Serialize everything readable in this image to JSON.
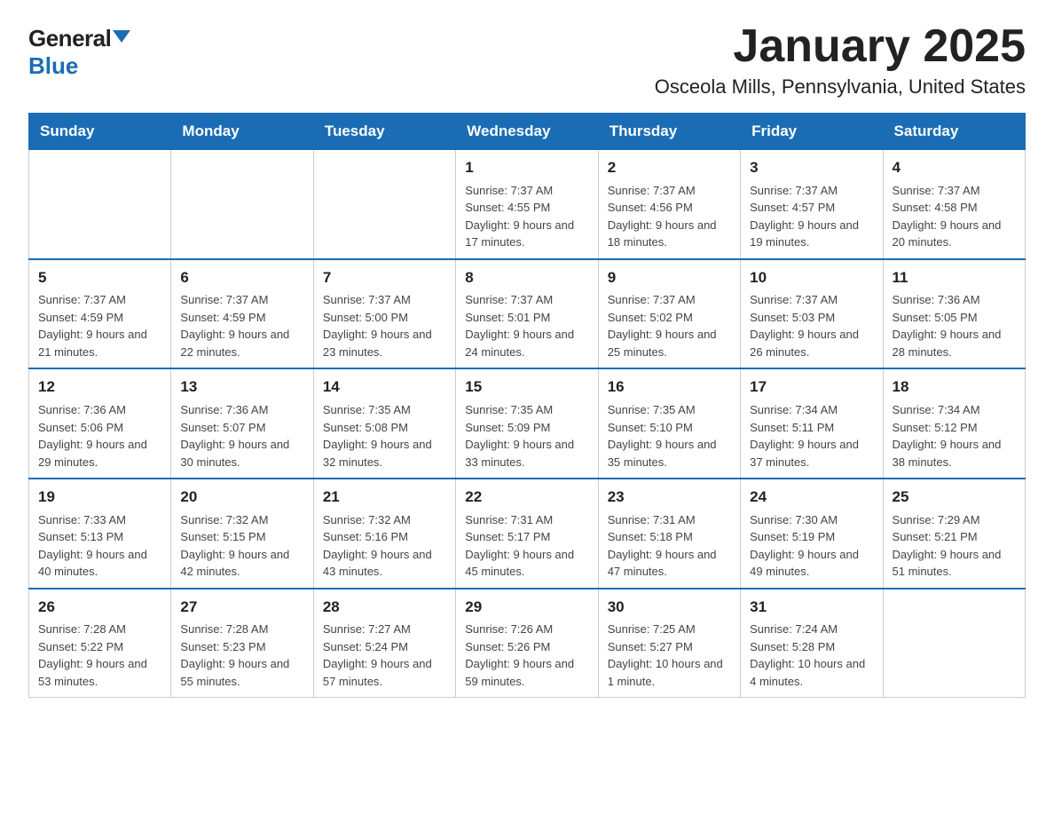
{
  "logo": {
    "general": "General",
    "blue": "Blue"
  },
  "title": "January 2025",
  "subtitle": "Osceola Mills, Pennsylvania, United States",
  "headers": [
    "Sunday",
    "Monday",
    "Tuesday",
    "Wednesday",
    "Thursday",
    "Friday",
    "Saturday"
  ],
  "weeks": [
    [
      {
        "day": "",
        "info": ""
      },
      {
        "day": "",
        "info": ""
      },
      {
        "day": "",
        "info": ""
      },
      {
        "day": "1",
        "info": "Sunrise: 7:37 AM\nSunset: 4:55 PM\nDaylight: 9 hours and 17 minutes."
      },
      {
        "day": "2",
        "info": "Sunrise: 7:37 AM\nSunset: 4:56 PM\nDaylight: 9 hours and 18 minutes."
      },
      {
        "day": "3",
        "info": "Sunrise: 7:37 AM\nSunset: 4:57 PM\nDaylight: 9 hours and 19 minutes."
      },
      {
        "day": "4",
        "info": "Sunrise: 7:37 AM\nSunset: 4:58 PM\nDaylight: 9 hours and 20 minutes."
      }
    ],
    [
      {
        "day": "5",
        "info": "Sunrise: 7:37 AM\nSunset: 4:59 PM\nDaylight: 9 hours and 21 minutes."
      },
      {
        "day": "6",
        "info": "Sunrise: 7:37 AM\nSunset: 4:59 PM\nDaylight: 9 hours and 22 minutes."
      },
      {
        "day": "7",
        "info": "Sunrise: 7:37 AM\nSunset: 5:00 PM\nDaylight: 9 hours and 23 minutes."
      },
      {
        "day": "8",
        "info": "Sunrise: 7:37 AM\nSunset: 5:01 PM\nDaylight: 9 hours and 24 minutes."
      },
      {
        "day": "9",
        "info": "Sunrise: 7:37 AM\nSunset: 5:02 PM\nDaylight: 9 hours and 25 minutes."
      },
      {
        "day": "10",
        "info": "Sunrise: 7:37 AM\nSunset: 5:03 PM\nDaylight: 9 hours and 26 minutes."
      },
      {
        "day": "11",
        "info": "Sunrise: 7:36 AM\nSunset: 5:05 PM\nDaylight: 9 hours and 28 minutes."
      }
    ],
    [
      {
        "day": "12",
        "info": "Sunrise: 7:36 AM\nSunset: 5:06 PM\nDaylight: 9 hours and 29 minutes."
      },
      {
        "day": "13",
        "info": "Sunrise: 7:36 AM\nSunset: 5:07 PM\nDaylight: 9 hours and 30 minutes."
      },
      {
        "day": "14",
        "info": "Sunrise: 7:35 AM\nSunset: 5:08 PM\nDaylight: 9 hours and 32 minutes."
      },
      {
        "day": "15",
        "info": "Sunrise: 7:35 AM\nSunset: 5:09 PM\nDaylight: 9 hours and 33 minutes."
      },
      {
        "day": "16",
        "info": "Sunrise: 7:35 AM\nSunset: 5:10 PM\nDaylight: 9 hours and 35 minutes."
      },
      {
        "day": "17",
        "info": "Sunrise: 7:34 AM\nSunset: 5:11 PM\nDaylight: 9 hours and 37 minutes."
      },
      {
        "day": "18",
        "info": "Sunrise: 7:34 AM\nSunset: 5:12 PM\nDaylight: 9 hours and 38 minutes."
      }
    ],
    [
      {
        "day": "19",
        "info": "Sunrise: 7:33 AM\nSunset: 5:13 PM\nDaylight: 9 hours and 40 minutes."
      },
      {
        "day": "20",
        "info": "Sunrise: 7:32 AM\nSunset: 5:15 PM\nDaylight: 9 hours and 42 minutes."
      },
      {
        "day": "21",
        "info": "Sunrise: 7:32 AM\nSunset: 5:16 PM\nDaylight: 9 hours and 43 minutes."
      },
      {
        "day": "22",
        "info": "Sunrise: 7:31 AM\nSunset: 5:17 PM\nDaylight: 9 hours and 45 minutes."
      },
      {
        "day": "23",
        "info": "Sunrise: 7:31 AM\nSunset: 5:18 PM\nDaylight: 9 hours and 47 minutes."
      },
      {
        "day": "24",
        "info": "Sunrise: 7:30 AM\nSunset: 5:19 PM\nDaylight: 9 hours and 49 minutes."
      },
      {
        "day": "25",
        "info": "Sunrise: 7:29 AM\nSunset: 5:21 PM\nDaylight: 9 hours and 51 minutes."
      }
    ],
    [
      {
        "day": "26",
        "info": "Sunrise: 7:28 AM\nSunset: 5:22 PM\nDaylight: 9 hours and 53 minutes."
      },
      {
        "day": "27",
        "info": "Sunrise: 7:28 AM\nSunset: 5:23 PM\nDaylight: 9 hours and 55 minutes."
      },
      {
        "day": "28",
        "info": "Sunrise: 7:27 AM\nSunset: 5:24 PM\nDaylight: 9 hours and 57 minutes."
      },
      {
        "day": "29",
        "info": "Sunrise: 7:26 AM\nSunset: 5:26 PM\nDaylight: 9 hours and 59 minutes."
      },
      {
        "day": "30",
        "info": "Sunrise: 7:25 AM\nSunset: 5:27 PM\nDaylight: 10 hours and 1 minute."
      },
      {
        "day": "31",
        "info": "Sunrise: 7:24 AM\nSunset: 5:28 PM\nDaylight: 10 hours and 4 minutes."
      },
      {
        "day": "",
        "info": ""
      }
    ]
  ]
}
